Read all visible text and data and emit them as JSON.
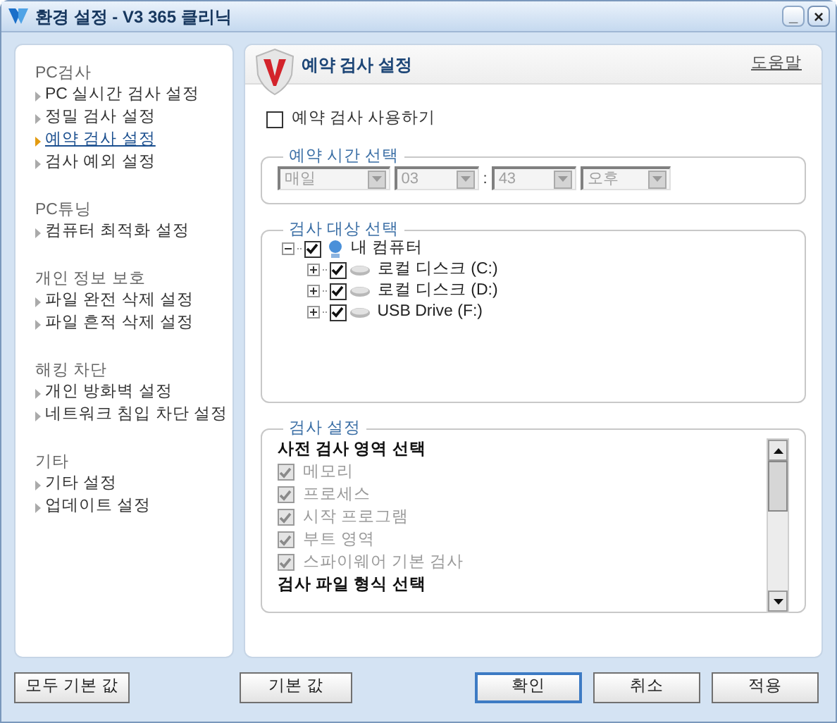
{
  "window": {
    "title": "환경 설정 - V3 365 클리닉",
    "controls": [
      {
        "kind": "minimize",
        "label": "_"
      },
      {
        "kind": "close",
        "label": "×"
      }
    ]
  },
  "sidebar": {
    "groups": [
      {
        "title": "PC검사",
        "items": [
          {
            "label": "PC 실시간 검사 설정",
            "selected": false
          },
          {
            "label": "정밀 검사 설정",
            "selected": false
          },
          {
            "label": "예약 검사 설정",
            "selected": true
          },
          {
            "label": "검사 예외 설정",
            "selected": false
          }
        ]
      },
      {
        "title": "PC튜닝",
        "items": [
          {
            "label": "컴퓨터 최적화 설정",
            "selected": false
          }
        ]
      },
      {
        "title": "개인 정보 보호",
        "items": [
          {
            "label": "파일 완전 삭제 설정",
            "selected": false
          },
          {
            "label": "파일 흔적 삭제 설정",
            "selected": false
          }
        ]
      },
      {
        "title": "해킹 차단",
        "items": [
          {
            "label": "개인 방화벽 설정",
            "selected": false
          },
          {
            "label": "네트워크 침입 차단 설정",
            "selected": false
          }
        ]
      },
      {
        "title": "기타",
        "items": [
          {
            "label": "기타 설정",
            "selected": false
          },
          {
            "label": "업데이트 설정",
            "selected": false
          }
        ]
      }
    ]
  },
  "content": {
    "title": "예약 검사 설정",
    "help_link": "도움말",
    "enable_checkbox": {
      "label": "예약 검사 사용하기",
      "checked": false
    },
    "schedule": {
      "legend": "예약 시간 선택",
      "fields": [
        {
          "kind": "select",
          "value": "매일",
          "disabled": true
        },
        {
          "kind": "select",
          "value": "03",
          "disabled": true
        },
        {
          "kind": "separator",
          "value": ":"
        },
        {
          "kind": "select",
          "value": "43",
          "disabled": true
        },
        {
          "kind": "select",
          "value": "오후",
          "disabled": true
        }
      ]
    },
    "targets": {
      "legend": "검사 대상 선택",
      "tree": [
        {
          "kind": "computer",
          "label": "내 컴퓨터",
          "checked": true,
          "expanded": true,
          "children": [
            {
              "kind": "drive",
              "label": "로컬 디스크 (C:)",
              "checked": true,
              "expanded": false
            },
            {
              "kind": "drive",
              "label": "로컬 디스크 (D:)",
              "checked": true,
              "expanded": false
            },
            {
              "kind": "drive",
              "label": "USB Drive (F:)",
              "checked": true,
              "expanded": false
            }
          ]
        }
      ]
    },
    "scan_settings": {
      "legend": "검사 설정",
      "items": [
        {
          "kind": "heading",
          "label": "사전 검사 영역 선택"
        },
        {
          "kind": "check",
          "label": "메모리",
          "checked": true,
          "disabled": true
        },
        {
          "kind": "check",
          "label": "프로세스",
          "checked": true,
          "disabled": true
        },
        {
          "kind": "check",
          "label": "시작 프로그램",
          "checked": true,
          "disabled": true
        },
        {
          "kind": "check",
          "label": "부트 영역",
          "checked": true,
          "disabled": true
        },
        {
          "kind": "check",
          "label": "스파이웨어 기본 검사",
          "checked": true,
          "disabled": true
        },
        {
          "kind": "heading",
          "label": "검사 파일 형식 선택"
        }
      ]
    }
  },
  "footer": {
    "left_button": {
      "label": "모두 기본 값"
    },
    "buttons": [
      {
        "label": "기본 값",
        "default": false
      },
      {
        "label": "확인",
        "default": true
      },
      {
        "label": "취소",
        "default": false
      },
      {
        "label": "적용",
        "default": false
      }
    ]
  }
}
